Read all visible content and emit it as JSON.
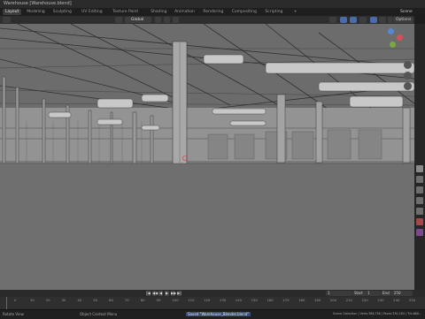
{
  "window": {
    "title": "Warehouse [Warehouse.blend]"
  },
  "workspaces": [
    "Layout",
    "Modeling",
    "Sculpting",
    "UV Editing",
    "Texture Paint",
    "Shading",
    "Animation",
    "Rendering",
    "Compositing",
    "Scripting",
    "+"
  ],
  "active_workspace": "Layout",
  "scene": {
    "label": "Scene"
  },
  "viewport_header": {
    "view_label": "Global",
    "options_label": "Options"
  },
  "timeline": {
    "ticks": [
      "0",
      "10",
      "20",
      "30",
      "40",
      "50",
      "60",
      "70",
      "80",
      "90",
      "100",
      "110",
      "120",
      "130",
      "140",
      "150",
      "160",
      "170",
      "180",
      "190",
      "200",
      "210",
      "220",
      "230",
      "240",
      "250"
    ],
    "current_frame": "1",
    "start_label": "Start",
    "start_value": "1",
    "end_label": "End",
    "end_value": "250"
  },
  "status_bar": {
    "left": "Rotate View",
    "middle": "Object Context Menu",
    "saved": "Saved \"Warehouse_Blender.blend\"",
    "right": "Scene Collection | Verts:386,756 | Faces:330,184 | Tris:660..."
  },
  "colors": {
    "accent": "#4b6ca8",
    "viewport_bg": "#7a7a7a",
    "floor": "#6f6f6f"
  }
}
